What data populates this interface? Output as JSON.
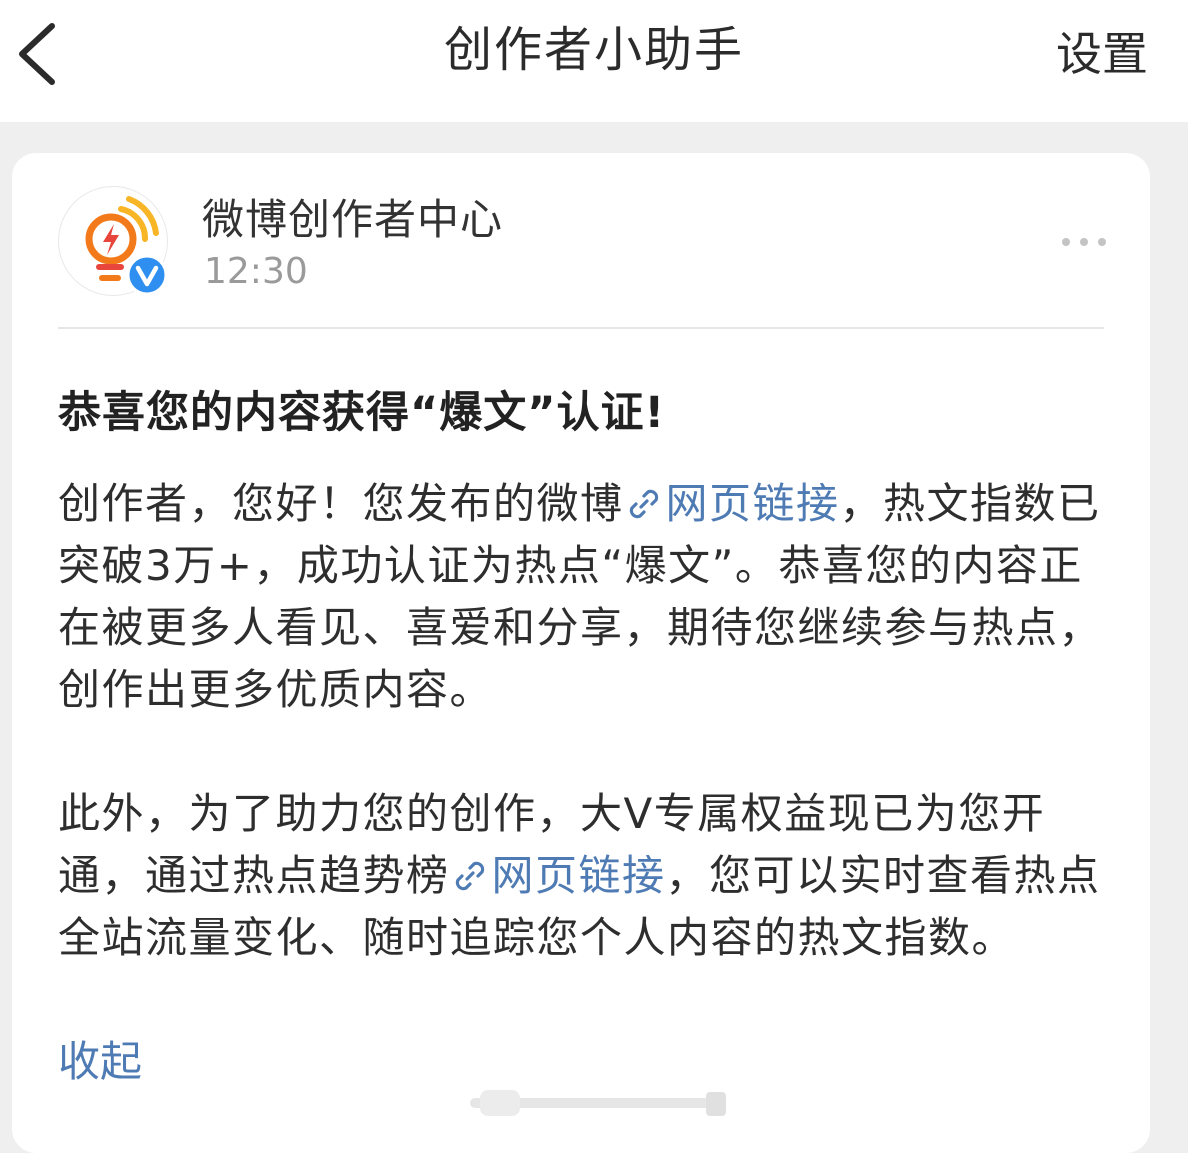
{
  "header": {
    "title": "创作者小助手",
    "settings_label": "设置"
  },
  "sender": {
    "name": "微博创作者中心",
    "time": "12:30"
  },
  "message": {
    "title": "恭喜您的内容获得“爆文”认证!",
    "p1_before": "创作者，您好！您发布的微博",
    "p1_link": "网页链接",
    "p1_after": "，热文指数已突破3万+，成功认证为热点“爆文”。恭喜您的内容正在被更多人看见、喜爱和分享，期待您继续参与热点，创作出更多优质内容。",
    "p2_before": "此外，为了助力您的创作，大V专属权益现已为您开通，通过热点趋势榜",
    "p2_link": "网页链接",
    "p2_after": "，您可以实时查看热点全站流量变化、随时追踪您个人内容的热文指数。",
    "collapse_label": "收起"
  },
  "colors": {
    "link": "#4f7bb4",
    "verified_badge": "#2f8ff0",
    "background": "#efefef",
    "logo_orange": "#f27a1a",
    "logo_red": "#e8453c",
    "logo_yellow": "#f8b526"
  },
  "icons": {
    "back": "chevron-left-icon",
    "more": "more-dots-icon",
    "link": "link-chain-icon",
    "verified": "verified-v-icon",
    "avatar": "lightbulb-lightning-logo"
  }
}
